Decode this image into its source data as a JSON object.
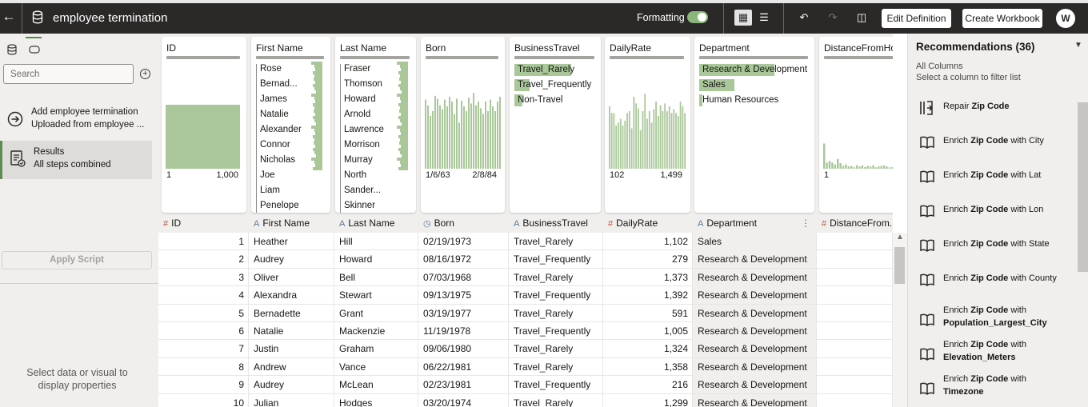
{
  "topbar": {
    "title": "employee termination",
    "formatting_label": "Formatting",
    "formatting_on": true,
    "edit_definition": "Edit Definition",
    "create_workbook": "Create Workbook",
    "user_initial": "W"
  },
  "left": {
    "search_placeholder": "Search",
    "steps": [
      {
        "title": "Add employee termination",
        "subtitle": "Uploaded from employee ..."
      },
      {
        "title": "Results",
        "subtitle": "All steps combined"
      }
    ],
    "apply_script": "Apply Script",
    "properties_hint_1": "Select data or visual to",
    "properties_hint_2": "display properties"
  },
  "cards": {
    "id": {
      "title": "ID",
      "min": "1",
      "max": "1,000"
    },
    "first_name": {
      "title": "First Name",
      "items": [
        "Rose",
        "Bernad...",
        "James",
        "Natalie",
        "Alexander",
        "Connor",
        "Nicholas",
        "Joe",
        "Liam",
        "Penelope"
      ]
    },
    "last_name": {
      "title": "Last Name",
      "items": [
        "Fraser",
        "Thomson",
        "Howard",
        "Arnold",
        "Lawrence",
        "Morrison",
        "Murray",
        "North",
        "Sander...",
        "Skinner"
      ]
    },
    "born": {
      "title": "Born",
      "min": "1/6/63",
      "max": "2/8/84",
      "histogram": [
        0.72,
        0.66,
        0.55,
        0.6,
        0.76,
        0.73,
        0.66,
        0.62,
        0.72,
        0.65,
        0.75,
        0.7,
        0.57,
        0.73,
        0.48,
        0.71,
        0.65,
        0.6,
        0.74,
        0.68,
        0.79,
        0.66,
        0.7,
        0.63,
        0.57,
        0.7,
        0.6,
        0.72,
        0.65,
        0.6,
        0.7,
        0.75
      ]
    },
    "business_travel": {
      "title": "BusinessTravel",
      "items": [
        {
          "label": "Travel_Rarely",
          "share": 0.71
        },
        {
          "label": "Travel_Frequently",
          "share": 0.19
        },
        {
          "label": "Non-Travel",
          "share": 0.1
        }
      ]
    },
    "daily_rate": {
      "title": "DailyRate",
      "min": "102",
      "max": "1,499",
      "histogram": [
        0.65,
        0.58,
        0.58,
        0.45,
        0.48,
        0.52,
        0.45,
        0.5,
        0.58,
        0.6,
        0.42,
        0.75,
        0.68,
        0.63,
        0.4,
        0.6,
        0.78,
        0.52,
        0.6,
        0.48,
        0.62,
        0.7,
        0.55,
        0.66,
        0.6,
        0.68,
        0.6,
        0.65,
        0.58,
        0.62,
        0.58,
        0.55,
        0.7,
        0.65,
        0.58
      ]
    },
    "department": {
      "title": "Department",
      "items": [
        {
          "label": "Research & Development",
          "share": 0.65
        },
        {
          "label": "Sales",
          "share": 0.3
        },
        {
          "label": "Human Resources",
          "share": 0.03
        }
      ]
    },
    "distance": {
      "title": "DistanceFromHo...",
      "min": "1",
      "histogram": [
        0.9,
        0.22,
        0.28,
        0.22,
        0.15,
        0.35,
        0.2,
        0.1,
        0.15,
        0.08,
        0.1,
        0.05,
        0.12,
        0.08,
        0.12,
        0.06,
        0.1,
        0.08,
        0.12,
        0.05,
        0.08,
        0.1,
        0.12,
        0.08,
        0.05,
        0.06,
        0.04
      ]
    }
  },
  "columns": [
    {
      "name": "ID",
      "type": "#"
    },
    {
      "name": "First Name",
      "type": "A"
    },
    {
      "name": "Last Name",
      "type": "A"
    },
    {
      "name": "Born",
      "type": "date"
    },
    {
      "name": "BusinessTravel",
      "type": "A"
    },
    {
      "name": "DailyRate",
      "type": "#"
    },
    {
      "name": "Department",
      "type": "A"
    },
    {
      "name": "DistanceFrom...",
      "type": "#"
    }
  ],
  "rows": [
    {
      "id": "1",
      "first": "Heather",
      "last": "Hill",
      "born": "02/19/1973",
      "travel": "Travel_Rarely",
      "rate": "1,102",
      "dept": "Sales"
    },
    {
      "id": "2",
      "first": "Audrey",
      "last": "Howard",
      "born": "08/16/1972",
      "travel": "Travel_Frequently",
      "rate": "279",
      "dept": "Research & Development"
    },
    {
      "id": "3",
      "first": "Oliver",
      "last": "Bell",
      "born": "07/03/1968",
      "travel": "Travel_Rarely",
      "rate": "1,373",
      "dept": "Research & Development"
    },
    {
      "id": "4",
      "first": "Alexandra",
      "last": "Stewart",
      "born": "09/13/1975",
      "travel": "Travel_Frequently",
      "rate": "1,392",
      "dept": "Research & Development"
    },
    {
      "id": "5",
      "first": "Bernadette",
      "last": "Grant",
      "born": "03/19/1977",
      "travel": "Travel_Rarely",
      "rate": "591",
      "dept": "Research & Development"
    },
    {
      "id": "6",
      "first": "Natalie",
      "last": "Mackenzie",
      "born": "11/19/1978",
      "travel": "Travel_Frequently",
      "rate": "1,005",
      "dept": "Research & Development"
    },
    {
      "id": "7",
      "first": "Justin",
      "last": "Graham",
      "born": "09/06/1980",
      "travel": "Travel_Rarely",
      "rate": "1,324",
      "dept": "Research & Development"
    },
    {
      "id": "8",
      "first": "Andrew",
      "last": "Vance",
      "born": "06/22/1981",
      "travel": "Travel_Rarely",
      "rate": "1,358",
      "dept": "Research & Development"
    },
    {
      "id": "9",
      "first": "Audrey",
      "last": "McLean",
      "born": "02/23/1981",
      "travel": "Travel_Frequently",
      "rate": "216",
      "dept": "Research & Development"
    },
    {
      "id": "10",
      "first": "Julian",
      "last": "Hodges",
      "born": "03/20/1974",
      "travel": "Travel_Rarely",
      "rate": "1,299",
      "dept": "Research & Development"
    }
  ],
  "recommendations": {
    "title": "Recommendations (36)",
    "sub1": "All Columns",
    "sub2": "Select a column to filter list",
    "items": [
      {
        "icon": "repair-icon",
        "pre": "Repair ",
        "bold": "Zip Code",
        "post": "",
        "line2": ""
      },
      {
        "icon": "book-icon",
        "pre": "Enrich ",
        "bold": "Zip Code",
        "post": " with City",
        "line2": ""
      },
      {
        "icon": "book-icon",
        "pre": "Enrich ",
        "bold": "Zip Code",
        "post": " with Lat",
        "line2": ""
      },
      {
        "icon": "book-icon",
        "pre": "Enrich ",
        "bold": "Zip Code",
        "post": " with Lon",
        "line2": ""
      },
      {
        "icon": "book-icon",
        "pre": "Enrich ",
        "bold": "Zip Code",
        "post": " with State",
        "line2": ""
      },
      {
        "icon": "book-icon",
        "pre": "Enrich ",
        "bold": "Zip Code",
        "post": " with County",
        "line2": ""
      },
      {
        "icon": "book-icon",
        "pre": "Enrich ",
        "bold": "Zip Code",
        "post": " with",
        "line2": "Population_Largest_City"
      },
      {
        "icon": "book-icon",
        "pre": "Enrich ",
        "bold": "Zip Code",
        "post": " with",
        "line2": "Elevation_Meters"
      },
      {
        "icon": "book-icon",
        "pre": "Enrich ",
        "bold": "Zip Code",
        "post": " with",
        "line2": "Timezone"
      }
    ]
  },
  "colors": {
    "accent": "#5f8a52",
    "bar": "#a9c798",
    "topbar": "#2b2928"
  }
}
